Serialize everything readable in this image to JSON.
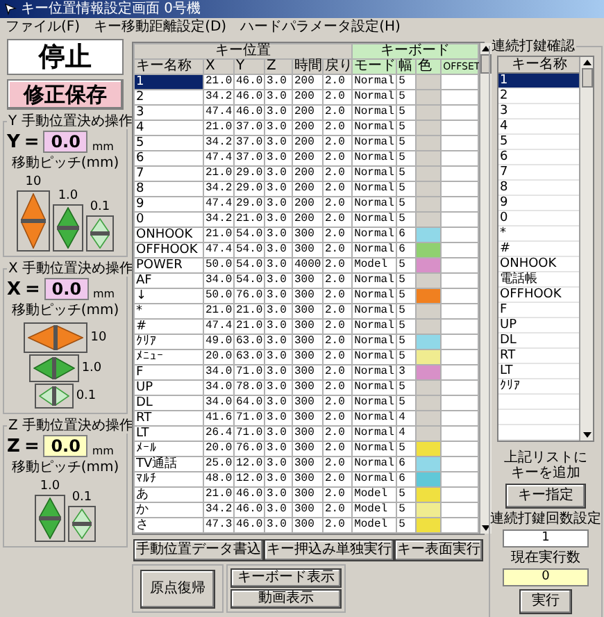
{
  "window": {
    "title": "キー位置情報設定画面 0号機"
  },
  "menu": [
    "ファイル(F)",
    "キー移動距離設定(D)",
    "ハードパラメータ設定(H)"
  ],
  "status": "停止",
  "save_button": "修正保存",
  "axes": [
    {
      "title": "Y 手動位置決め操作",
      "axis": "Y",
      "equals": "=",
      "value": "0.0",
      "unit": "mm",
      "color": "#f0c8ec",
      "pitch_label": "移動ピッチ(mm)",
      "kind": "vertical",
      "steps": [
        {
          "label": "10",
          "kind": "coarse"
        },
        {
          "label": "1.0",
          "kind": "medium"
        },
        {
          "label": "0.1",
          "kind": "fine"
        }
      ]
    },
    {
      "title": "X 手動位置決め操作",
      "axis": "X",
      "equals": "=",
      "value": "0.0",
      "unit": "mm",
      "color": "#f0c8ec",
      "pitch_label": "移動ピッチ(mm)",
      "kind": "horizontal",
      "steps": [
        {
          "label": "10",
          "kind": "coarse"
        },
        {
          "label": "1.0",
          "kind": "medium"
        },
        {
          "label": "0.1",
          "kind": "fine"
        }
      ]
    },
    {
      "title": "Z 手動位置決め操作",
      "axis": "Z",
      "equals": "=",
      "value": "0.0",
      "unit": "mm",
      "color": "#ffffc0",
      "pitch_label": "移動ピッチ(mm)",
      "kind": "vertical",
      "steps": [
        {
          "label": "1.0",
          "kind": "medium"
        },
        {
          "label": "0.1",
          "kind": "fine"
        }
      ]
    }
  ],
  "table": {
    "group_headers": [
      {
        "label": "キー位置",
        "kind": "position"
      },
      {
        "label": "キーボード",
        "kind": "keyboard"
      }
    ],
    "columns": [
      "キー名称",
      "X",
      "Y",
      "Z",
      "時間",
      "戻り",
      "モード",
      "幅",
      "色",
      "OFFSET"
    ],
    "rows": [
      {
        "cells": [
          "1",
          "21.0",
          "46.0",
          "3.0",
          "200",
          "2.0",
          "Normal",
          "5"
        ],
        "color": "#d4d0c8",
        "selected": true
      },
      {
        "cells": [
          "2",
          "34.2",
          "46.0",
          "3.0",
          "200",
          "2.0",
          "Normal",
          "5"
        ],
        "color": "#d4d0c8",
        "selected": false
      },
      {
        "cells": [
          "3",
          "47.4",
          "46.0",
          "3.0",
          "200",
          "2.0",
          "Normal",
          "5"
        ],
        "color": "#d4d0c8",
        "selected": false
      },
      {
        "cells": [
          "4",
          "21.0",
          "37.0",
          "3.0",
          "200",
          "2.0",
          "Normal",
          "5"
        ],
        "color": "#d4d0c8",
        "selected": false
      },
      {
        "cells": [
          "5",
          "34.2",
          "37.0",
          "3.0",
          "200",
          "2.0",
          "Normal",
          "5"
        ],
        "color": "#d4d0c8",
        "selected": false
      },
      {
        "cells": [
          "6",
          "47.4",
          "37.0",
          "3.0",
          "200",
          "2.0",
          "Normal",
          "5"
        ],
        "color": "#d4d0c8",
        "selected": false
      },
      {
        "cells": [
          "7",
          "21.0",
          "29.0",
          "3.0",
          "200",
          "2.0",
          "Normal",
          "5"
        ],
        "color": "#d4d0c8",
        "selected": false
      },
      {
        "cells": [
          "8",
          "34.2",
          "29.0",
          "3.0",
          "200",
          "2.0",
          "Normal",
          "5"
        ],
        "color": "#d4d0c8",
        "selected": false
      },
      {
        "cells": [
          "9",
          "47.4",
          "29.0",
          "3.0",
          "200",
          "2.0",
          "Normal",
          "5"
        ],
        "color": "#d4d0c8",
        "selected": false
      },
      {
        "cells": [
          "0",
          "34.2",
          "21.0",
          "3.0",
          "200",
          "2.0",
          "Normal",
          "5"
        ],
        "color": "#d4d0c8",
        "selected": false
      },
      {
        "cells": [
          "ONHOOK",
          "21.0",
          "54.0",
          "3.0",
          "300",
          "2.0",
          "Normal",
          "6"
        ],
        "color": "#90d8e8",
        "selected": false
      },
      {
        "cells": [
          "OFFHOOK",
          "47.4",
          "54.0",
          "3.0",
          "300",
          "2.0",
          "Normal",
          "6"
        ],
        "color": "#90d070",
        "selected": false
      },
      {
        "cells": [
          "POWER",
          "50.0",
          "54.0",
          "3.0",
          "4000",
          "2.0",
          "Model",
          "5"
        ],
        "color": "#d890c8",
        "selected": false
      },
      {
        "cells": [
          "AF",
          "34.0",
          "54.0",
          "3.0",
          "300",
          "2.0",
          "Normal",
          "5"
        ],
        "color": "#d4d0c8",
        "selected": false
      },
      {
        "cells": [
          "↓",
          "50.0",
          "76.0",
          "3.0",
          "300",
          "2.0",
          "Normal",
          "5"
        ],
        "color": "#f08020",
        "selected": false
      },
      {
        "cells": [
          "*",
          "21.0",
          "21.0",
          "3.0",
          "300",
          "2.0",
          "Normal",
          "5"
        ],
        "color": "#d4d0c8",
        "selected": false
      },
      {
        "cells": [
          "#",
          "47.4",
          "21.0",
          "3.0",
          "300",
          "2.0",
          "Normal",
          "5"
        ],
        "color": "#d4d0c8",
        "selected": false
      },
      {
        "cells": [
          "ｸﾘｱ",
          "49.0",
          "63.0",
          "3.0",
          "300",
          "2.0",
          "Normal",
          "5"
        ],
        "color": "#90d8e8",
        "selected": false
      },
      {
        "cells": [
          "ﾒﾆｭｰ",
          "20.0",
          "63.0",
          "3.0",
          "300",
          "2.0",
          "Normal",
          "5"
        ],
        "color": "#f0ec90",
        "selected": false
      },
      {
        "cells": [
          "F",
          "34.0",
          "71.0",
          "3.0",
          "300",
          "2.0",
          "Normal",
          "3"
        ],
        "color": "#d890c8",
        "selected": false
      },
      {
        "cells": [
          "UP",
          "34.0",
          "78.0",
          "3.0",
          "300",
          "2.0",
          "Normal",
          "5"
        ],
        "color": "#d4d0c8",
        "selected": false
      },
      {
        "cells": [
          "DL",
          "34.0",
          "64.0",
          "3.0",
          "300",
          "2.0",
          "Normal",
          "5"
        ],
        "color": "#d4d0c8",
        "selected": false
      },
      {
        "cells": [
          "RT",
          "41.6",
          "71.0",
          "3.0",
          "300",
          "2.0",
          "Normal",
          "4"
        ],
        "color": "#d4d0c8",
        "selected": false
      },
      {
        "cells": [
          "LT",
          "26.4",
          "71.0",
          "3.0",
          "300",
          "2.0",
          "Normal",
          "4"
        ],
        "color": "#d4d0c8",
        "selected": false
      },
      {
        "cells": [
          "ﾒｰﾙ",
          "20.0",
          "76.0",
          "3.0",
          "300",
          "2.0",
          "Normal",
          "5"
        ],
        "color": "#f0e040",
        "selected": false
      },
      {
        "cells": [
          "TV通話",
          "25.0",
          "12.0",
          "3.0",
          "300",
          "2.0",
          "Normal",
          "6"
        ],
        "color": "#90d8e8",
        "selected": false
      },
      {
        "cells": [
          "ﾏﾙﾁ",
          "48.0",
          "12.0",
          "3.0",
          "300",
          "2.0",
          "Normal",
          "6"
        ],
        "color": "#60c8d8",
        "selected": false
      },
      {
        "cells": [
          "あ",
          "21.0",
          "46.0",
          "3.0",
          "300",
          "2.0",
          "Model",
          "5"
        ],
        "color": "#f0e040",
        "selected": false
      },
      {
        "cells": [
          "か",
          "34.2",
          "46.0",
          "3.0",
          "300",
          "2.0",
          "Model",
          "5"
        ],
        "color": "#f0ec90",
        "selected": false
      },
      {
        "cells": [
          "さ",
          "47.3",
          "46.0",
          "3.0",
          "300",
          "2.0",
          "Model",
          "5"
        ],
        "color": "#f0e040",
        "selected": false
      }
    ]
  },
  "actions": [
    "手動位置データ書込",
    "キー押込み単独実行",
    "キー表面実行"
  ],
  "home_button": "原点復帰",
  "view_buttons": [
    "キーボード表示",
    "動画表示"
  ],
  "repeat_panel": {
    "title": "連続打鍵確認",
    "list_header": "キー名称",
    "items": [
      {
        "label": "1",
        "selected": true
      },
      {
        "label": "2",
        "selected": false
      },
      {
        "label": "3",
        "selected": false
      },
      {
        "label": "4",
        "selected": false
      },
      {
        "label": "5",
        "selected": false
      },
      {
        "label": "6",
        "selected": false
      },
      {
        "label": "7",
        "selected": false
      },
      {
        "label": "8",
        "selected": false
      },
      {
        "label": "9",
        "selected": false
      },
      {
        "label": "0",
        "selected": false
      },
      {
        "label": "*",
        "selected": false
      },
      {
        "label": "#",
        "selected": false
      },
      {
        "label": "ONHOOK",
        "selected": false
      },
      {
        "label": "電話帳",
        "selected": false
      },
      {
        "label": "OFFHOOK",
        "selected": false
      },
      {
        "label": "F",
        "selected": false
      },
      {
        "label": "UP",
        "selected": false
      },
      {
        "label": "DL",
        "selected": false
      },
      {
        "label": "RT",
        "selected": false
      },
      {
        "label": "LT",
        "selected": false
      },
      {
        "label": "ｸﾘｱ",
        "selected": false
      }
    ],
    "hint_lines": [
      "上記リストに",
      "キーを追加"
    ],
    "add_button": "キー指定",
    "repeat_label": "連続打鍵回数設定",
    "repeat_value": "1",
    "count_label": "現在実行数",
    "count_value": "0",
    "run_button": "実行"
  }
}
